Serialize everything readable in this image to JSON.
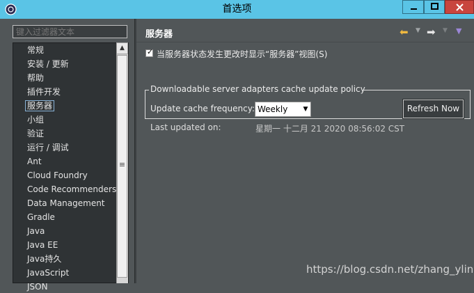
{
  "window": {
    "title": "首选项",
    "controls": {
      "minimize": "—",
      "maximize": "□",
      "close": "✕"
    }
  },
  "filter": {
    "placeholder": "键入过滤器文本",
    "value": ""
  },
  "tree": {
    "selected": "服务器",
    "items": [
      "常规",
      "安装 / 更新",
      "帮助",
      "插件开发",
      "服务器",
      "小组",
      "验证",
      "运行 / 调试",
      "Ant",
      "Cloud Foundry",
      "Code Recommenders",
      "Data Management",
      "Gradle",
      "Java",
      "Java EE",
      "Java持久",
      "JavaScript",
      "JSON"
    ]
  },
  "page": {
    "title": "服务器",
    "show_view_checkbox": {
      "label": "当服务器状态发生更改时显示“服务器”视图(S)",
      "checked": true
    }
  },
  "cache_policy": {
    "group_title": "Downloadable server adapters cache update policy",
    "frequency_label": "Update cache frequency:",
    "frequency_value": "Weekly",
    "refresh_label": "Refresh Now",
    "last_updated_label": "Last updated on:",
    "last_updated_value": "星期一 十二月 21 2020 08:56:02 CST"
  },
  "watermark": "https://blog.csdn.net/zhang_yling"
}
